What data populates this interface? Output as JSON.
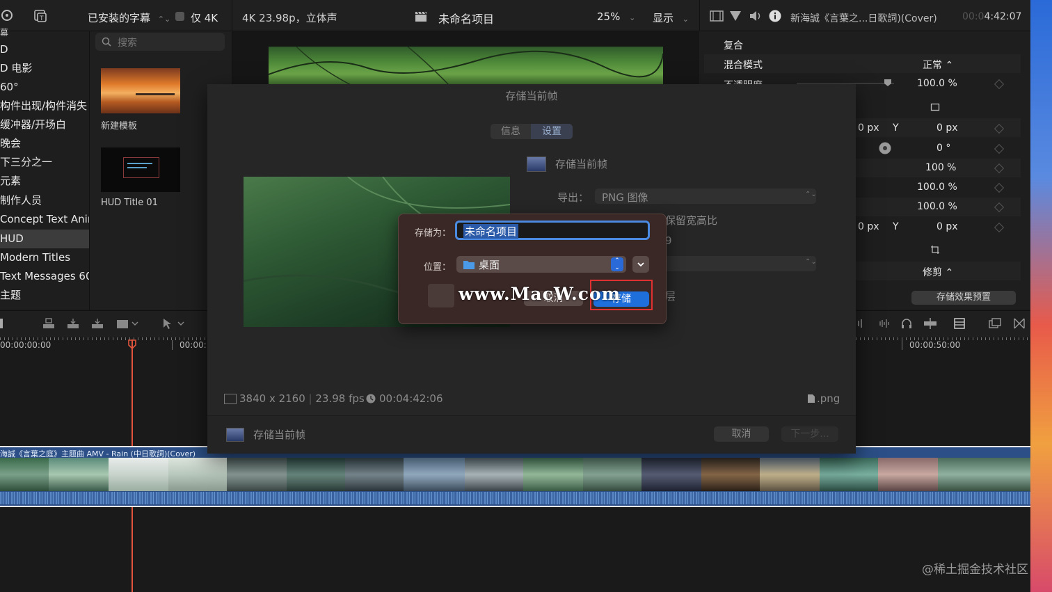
{
  "toolbar": {
    "installed_titles": "已安装的字幕",
    "only_4k": "仅 4K",
    "format": "4K 23.98p，立体声",
    "project_name": "未命名项目",
    "zoom": "25%",
    "display": "显示",
    "clip_name": "新海誠《言葉之...日歌詞)(Cover)",
    "timecode_dim": "00:0",
    "timecode": "4:42:07"
  },
  "sidebar": {
    "top_char": "幕",
    "items": [
      "D",
      "D 电影",
      "60°",
      "构件出现/构件消失",
      "缓冲器/开场白",
      "晚会",
      "下三分之一",
      "元素",
      "制作人员",
      "Concept Text Anima",
      "HUD",
      "Modern Titles",
      "Text Messages 60",
      "主题"
    ]
  },
  "browser": {
    "search_placeholder": "搜索",
    "items": [
      {
        "label": "新建模板"
      },
      {
        "label": "HUD Title 01"
      }
    ]
  },
  "inspector": {
    "section_composite": "复合",
    "blend_mode_label": "混合模式",
    "blend_mode_value": "正常 ⌃",
    "opacity_label": "不透明度",
    "opacity_value": "100.0 %",
    "pos_x_unit": "0 px",
    "pos_y_label": "Y",
    "pos_y_value": "0 px",
    "rotation_value": "0 °",
    "scale_all": "100 %",
    "scale_x": "100.0 %",
    "scale_y": "100.0 %",
    "anchor_x_unit": "0 px",
    "anchor_y_label": "Y",
    "anchor_y_value": "0 px",
    "crop_value": "修剪 ⌃",
    "save_preset": "存储效果预置"
  },
  "export_sheet": {
    "title": "存储当前帧",
    "tab_info": "信息",
    "tab_settings": "设置",
    "preset_name": "存储当前帧",
    "export_label": "导出：",
    "export_value": "PNG 图像",
    "keep_aspect": "保留宽高比",
    "partial_9": "9",
    "partial_layer": "层",
    "resolution": "3840 x 2160",
    "fps": "23.98 fps",
    "duration": "00:04:42:06",
    "extension": ".png",
    "footer_name": "存储当前帧",
    "cancel": "取消",
    "next": "下一步..."
  },
  "save_dialog": {
    "save_as_label": "存储为：",
    "save_as_value": "未命名项目",
    "location_label": "位置：",
    "location_value": "桌面",
    "cancel": "取消",
    "save": "存储"
  },
  "watermark": "www.MacW.com",
  "timeline": {
    "tc_start": "00:00:00:00",
    "tc_mid": "00:00:",
    "tc_end": "00:00:50:00",
    "clip_title": "海誠《言葉之庭》主题曲 AMV - Rain (中日歌詞)(Cover)"
  },
  "footer_watermark": "@稀土掘金技术社区",
  "colors": {
    "accent_blue": "#1e6fdc",
    "highlight_red": "#e03030",
    "playhead": "#e2553c",
    "clip_blue": "#2e5e9e"
  }
}
